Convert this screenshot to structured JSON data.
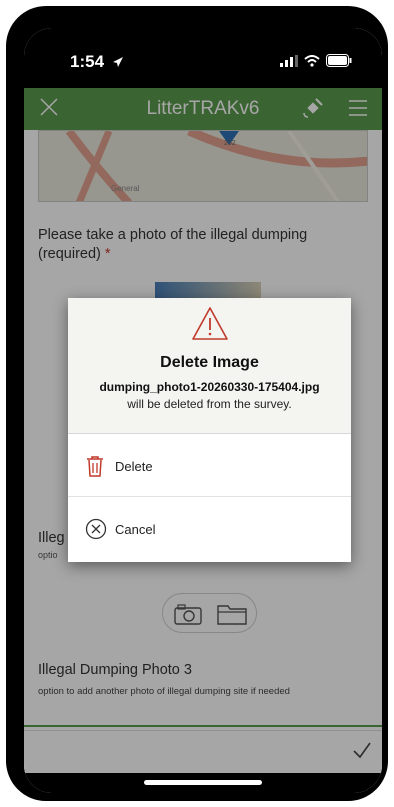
{
  "status_bar": {
    "time": "1:54"
  },
  "header": {
    "title": "LitterTRAKv6"
  },
  "map": {
    "labels": [
      "202",
      "General"
    ]
  },
  "question1": {
    "text": "Please take a photo of the illegal dumping (required)",
    "required_mark": "*"
  },
  "question2": {
    "text": "Illeg",
    "hint": "optio"
  },
  "question3": {
    "text": "Illegal Dumping Photo 3",
    "hint": "option to add another photo of illegal dumping site if needed"
  },
  "dialog": {
    "title": "Delete Image",
    "filename": "dumping_photo1-20260330-175404.jpg",
    "message": "will be deleted from the survey.",
    "delete_label": "Delete",
    "cancel_label": "Cancel"
  },
  "colors": {
    "header": "#5a9a4c",
    "danger": "#c0392b"
  }
}
